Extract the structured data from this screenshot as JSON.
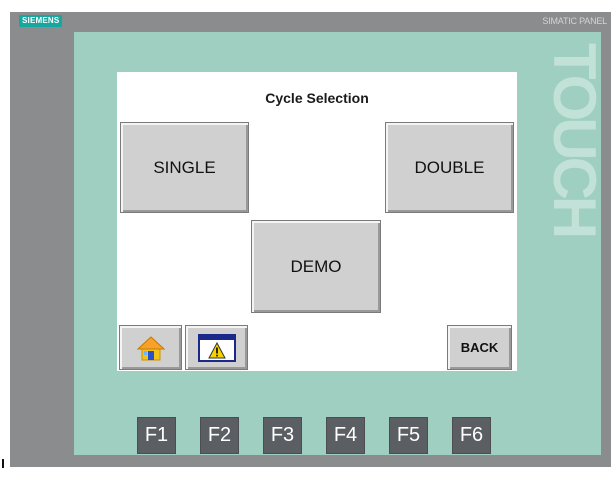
{
  "device": {
    "brand": "SIEMENS",
    "model": "SIMATIC PANEL",
    "side_label": "TOUCH"
  },
  "screen": {
    "title": "Cycle Selection",
    "buttons": {
      "single": "SINGLE",
      "double": "DOUBLE",
      "demo": "DEMO",
      "back": "BACK"
    },
    "icons": {
      "home": "home-icon",
      "alarm": "alarm-warning-icon"
    }
  },
  "function_keys": [
    "F1",
    "F2",
    "F3",
    "F4",
    "F5",
    "F6"
  ],
  "colors": {
    "bezel": "#9fcfc1",
    "frame": "#8a8c8e",
    "brand_badge": "#16a7a0",
    "button_face": "#d0d0d0",
    "function_key": "#5b5e62"
  }
}
